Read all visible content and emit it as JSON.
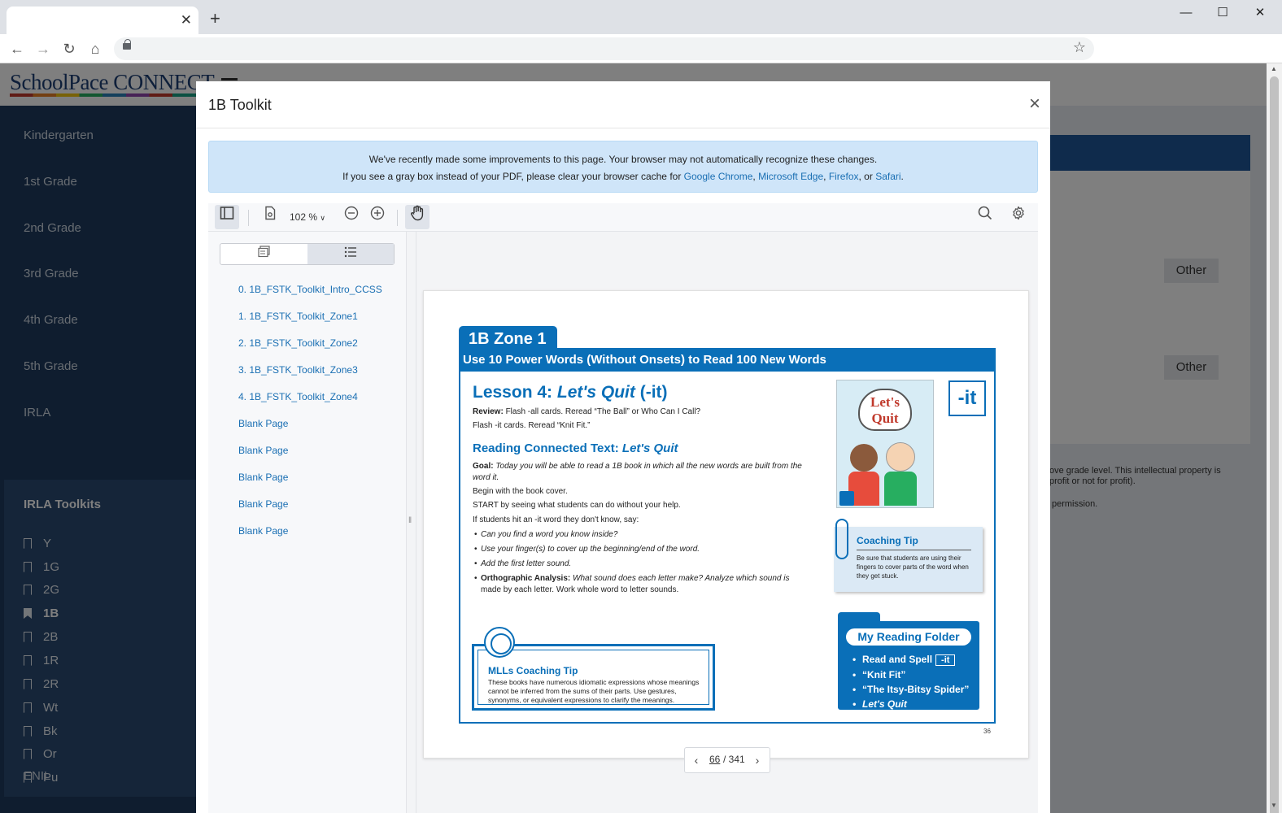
{
  "browser": {
    "tab_close": "✕",
    "new_tab": "+",
    "window": {
      "minimize": "—",
      "maximize": "☐",
      "close": "✕"
    },
    "nav": {
      "back": "←",
      "forward": "→",
      "reload": "↻",
      "home": "⌂"
    },
    "bookmark_star": "☆"
  },
  "app": {
    "logo": "SchoolPace CONNECT",
    "sidebar": {
      "items": [
        "Kindergarten",
        "1st Grade",
        "2nd Grade",
        "3rd Grade",
        "4th Grade",
        "5th Grade",
        "IRLA"
      ],
      "group_title": "IRLA Toolkits",
      "group_items": [
        "Y",
        "1G",
        "2G",
        "1B",
        "2B",
        "1R",
        "2R",
        "Wt",
        "Bk",
        "Or",
        "Pu"
      ],
      "active_item": "1B",
      "bottom_item": "ENIL"
    },
    "right_panel": {
      "other_label": "Other",
      "text_line1": "ove grade level. This intellectual property is",
      "text_line2": "profit or not for profit).",
      "text_line3": "permission."
    }
  },
  "modal": {
    "title": "1B Toolkit",
    "close": "×",
    "notice": {
      "line1": "We've recently made some improvements to this page. Your browser may not automatically recognize these changes.",
      "line2_prefix": "If you see a gray box instead of your PDF, please clear your browser cache for",
      "link_chrome": "Google Chrome",
      "link_edge": "Microsoft Edge",
      "link_firefox": "Firefox",
      "link_safari": "Safari",
      "sep1": ",",
      "sep2": ",",
      "sep3": ", or",
      "end": "."
    },
    "viewer": {
      "zoom": "102 %",
      "outline": [
        "0. 1B_FSTK_Toolkit_Intro_CCSS",
        "1. 1B_FSTK_Toolkit_Zone1",
        "2. 1B_FSTK_Toolkit_Zone2",
        "3. 1B_FSTK_Toolkit_Zone3",
        "4. 1B_FSTK_Toolkit_Zone4",
        "Blank Page",
        "Blank Page",
        "Blank Page",
        "Blank Page",
        "Blank Page"
      ],
      "current_page": "66",
      "total_pages": "/ 341"
    },
    "pdf": {
      "zone_tab": "1B Zone 1",
      "zone_band": "Use 10 Power Words (Without Onsets) to Read 100 New Words",
      "lesson_prefix": "Lesson 4: ",
      "lesson_italic": "Let's Quit",
      "lesson_suffix": " (-it)",
      "review_label": "Review:",
      "review_text": "Flash -all cards. Reread “The Ball” or Who Can I Call?",
      "flash_text": "Flash -it cards. Reread “Knit Fit.”",
      "rct_prefix": "Reading Connected Text: ",
      "rct_italic": "Let's Quit",
      "goal_label": "Goal:",
      "goal_text1": "Today you will be able to read a 1B book in which all the new words are built from the",
      "goal_text2": "word it.",
      "begin": "Begin with the book cover.",
      "start": "START by seeing what students can do without your help.",
      "if_students": "If students hit an -it word they don't know, say:",
      "bullets": [
        "Can you find a word you know inside?",
        "Use your finger(s) to cover up the beginning/end of the word.",
        "Add the first letter sound."
      ],
      "ortho_label": "Orthographic Analysis:",
      "ortho_text1": "What sound does each letter make? Analyze which sound is",
      "ortho_text2": "made by each letter. Work whole word to letter sounds.",
      "book_title": "Let's Quit",
      "it_box": "-it",
      "coach_title": "Coaching Tip",
      "coach_text": "Be sure that students are using their fingers to cover parts of the word when they get stuck.",
      "folder_title": "My Reading Folder",
      "folder_items": [
        "Read and Spell",
        "“Knit Fit”",
        "“The Itsy-Bitsy Spider”",
        "Let's Quit"
      ],
      "folder_it": "-it",
      "mll_title": "MLLs Coaching Tip",
      "mll_text": "These books have numerous idiomatic expressions whose meanings cannot be inferred from the sums of their parts. Use gestures, synonyms, or equivalent expressions to clarify the meanings.",
      "page_number": "36"
    }
  },
  "colors": {
    "brand_blue": "#0a6fb8",
    "sidebar": "#1e3a5f",
    "link": "#1a6fb3"
  }
}
